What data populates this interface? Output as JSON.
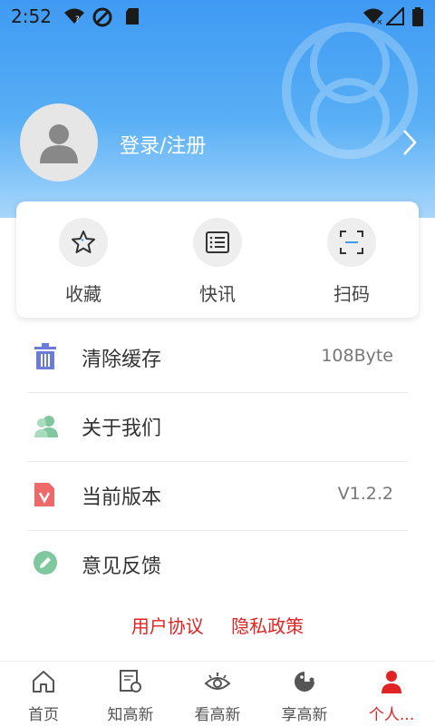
{
  "status": {
    "time": "2:52"
  },
  "profile": {
    "login_label": "登录/注册"
  },
  "quick_actions": [
    {
      "label": "收藏",
      "icon": "star-icon"
    },
    {
      "label": "快讯",
      "icon": "list-icon"
    },
    {
      "label": "扫码",
      "icon": "scan-icon"
    }
  ],
  "menu": [
    {
      "label": "清除缓存",
      "value": "108Byte",
      "icon": "trash-icon"
    },
    {
      "label": "关于我们",
      "value": "",
      "icon": "users-icon"
    },
    {
      "label": "当前版本",
      "value": "V1.2.2",
      "icon": "version-icon"
    },
    {
      "label": "意见反馈",
      "value": "",
      "icon": "pencil-icon"
    }
  ],
  "links": {
    "user_agreement": "用户协议",
    "privacy_policy": "隐私政策"
  },
  "tabs": [
    {
      "label": "首页",
      "icon": "home-icon"
    },
    {
      "label": "知高新",
      "icon": "news-icon"
    },
    {
      "label": "看高新",
      "icon": "eye-icon"
    },
    {
      "label": "享高新",
      "icon": "share-icon"
    },
    {
      "label": "个人...",
      "icon": "person-icon"
    }
  ],
  "colors": {
    "header_blue": "#3f9af3",
    "accent_red": "#e02424"
  }
}
